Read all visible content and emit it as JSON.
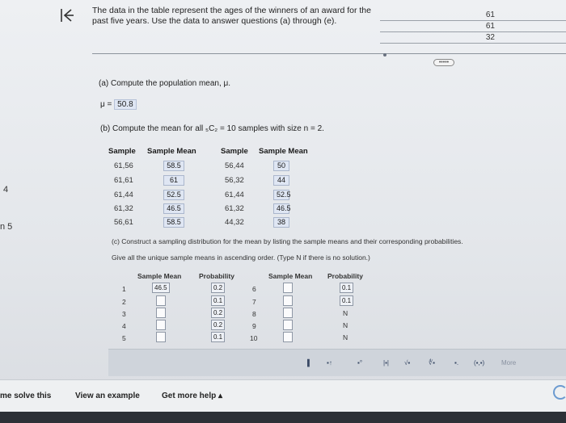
{
  "left_numbers": [
    "4",
    "n 5"
  ],
  "instructions": "The data in the table represent the ages of the winners of an award for the past five years. Use the data to answer questions (a) through (e).",
  "data_table": [
    "61",
    "61",
    "32"
  ],
  "more_pill": "•••••",
  "part_a": {
    "prompt": "(a) Compute the population mean, μ.",
    "label": "μ =",
    "answer": "50.8"
  },
  "part_b": {
    "prompt": "(b) Compute the mean for all ₅C₂ = 10 samples with size n = 2."
  },
  "samples_table": {
    "headers": [
      "Sample",
      "Sample Mean",
      "Sample",
      "Sample Mean"
    ],
    "left": [
      {
        "sample": "61,56",
        "mean": "58.5"
      },
      {
        "sample": "61,61",
        "mean": "61"
      },
      {
        "sample": "61,44",
        "mean": "52.5"
      },
      {
        "sample": "61,32",
        "mean": "46.5"
      },
      {
        "sample": "56,61",
        "mean": "58.5"
      }
    ],
    "right": [
      {
        "sample": "56,44",
        "mean": "50"
      },
      {
        "sample": "56,32",
        "mean": "44"
      },
      {
        "sample": "61,44",
        "mean": "52.5"
      },
      {
        "sample": "61,32",
        "mean": "46.5"
      },
      {
        "sample": "44,32",
        "mean": "38"
      }
    ]
  },
  "part_c": {
    "prompt": "(c) Construct a sampling distribution for the mean by listing the sample means and their corresponding probabilities.",
    "sub": "Give all the unique sample means in ascending order. (Type N if there is no solution.)",
    "headers": [
      "Sample Mean",
      "Probability",
      "Sample Mean",
      "Probability"
    ],
    "left_rows": [
      {
        "n": "1",
        "mean": "46.5",
        "prob": "0.2"
      },
      {
        "n": "2",
        "mean": "",
        "prob": "0.1"
      },
      {
        "n": "3",
        "mean": "",
        "prob": "0.2"
      },
      {
        "n": "4",
        "mean": "",
        "prob": "0.2"
      },
      {
        "n": "5",
        "mean": "",
        "prob": "0.1"
      }
    ],
    "right_rows": [
      {
        "n": "6",
        "mean": "",
        "prob": "0.1"
      },
      {
        "n": "7",
        "mean": "",
        "prob": "0.1"
      },
      {
        "n": "8",
        "mean": "",
        "prob": "N"
      },
      {
        "n": "9",
        "mean": "",
        "prob": "N"
      },
      {
        "n": "10",
        "mean": "",
        "prob": "N"
      }
    ]
  },
  "toolbar": [
    "▌",
    "▪↑",
    "▪°",
    "|▪|",
    "√▪",
    "∜▪",
    "▪.",
    "(▪,▪)",
    "More"
  ],
  "footer": {
    "solve": "me solve this",
    "example": "View an example",
    "help": "Get more help ▴"
  }
}
